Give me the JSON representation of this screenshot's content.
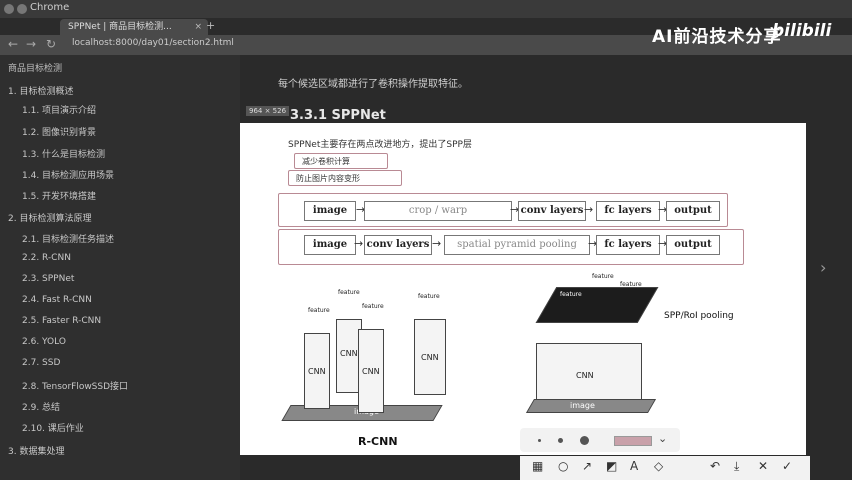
{
  "browser": {
    "app_name": "Chrome",
    "tab_title": "SPPNet | 商品目标检测...",
    "tab_close": "×",
    "new_tab": "+",
    "url": "localhost:8000/day01/section2.html"
  },
  "watermark": {
    "text": "AI前沿技术分享",
    "logo": "bilibili"
  },
  "sidebar": {
    "title": "商品目标检测",
    "items": [
      "1. 目标检测概述",
      "1.1. 项目演示介绍",
      "1.2. 图像识别背景",
      "1.3. 什么是目标检测",
      "1.4. 目标检测应用场景",
      "1.5. 开发环境搭建",
      "2. 目标检测算法原理",
      "2.1. 目标检测任务描述",
      "2.2. R-CNN",
      "2.3. SPPNet",
      "2.4. Fast R-CNN",
      "2.5. Faster R-CNN",
      "2.6. YOLO",
      "2.7. SSD",
      "2.8. TensorFlowSSD接口",
      "2.9. 总结",
      "2.10. 课后作业",
      "3. 数据集处理"
    ]
  },
  "content": {
    "intro": "每个候选区域都进行了卷积操作提取特征。",
    "heading": "3.3.1 SPPNet",
    "dim_badge": "964 × 526"
  },
  "slide": {
    "text": "SPPNet主要存在两点改进地方，提出了SPP层",
    "bullet1": "减少卷积计算",
    "bullet2": "防止图片内容变形",
    "row1": [
      "image",
      "crop / warp",
      "conv layers",
      "fc layers",
      "output"
    ],
    "row2": [
      "image",
      "conv layers",
      "spatial pyramid pooling",
      "fc layers",
      "output"
    ],
    "feature": "feature",
    "cnn": "CNN",
    "image": "image",
    "rcnn": "R-CNN",
    "spp": "SPP/RoI pooling"
  },
  "nav": {
    "back": "←",
    "forward": "→",
    "reload": "↻",
    "prev": "‹",
    "next": "›"
  },
  "bottom_tools": [
    "▦",
    "○",
    "↗",
    "◩",
    "A",
    "◇",
    "↶",
    "⤓",
    "✕",
    "✓"
  ],
  "colors": {
    "annotation": "#b98a94"
  }
}
